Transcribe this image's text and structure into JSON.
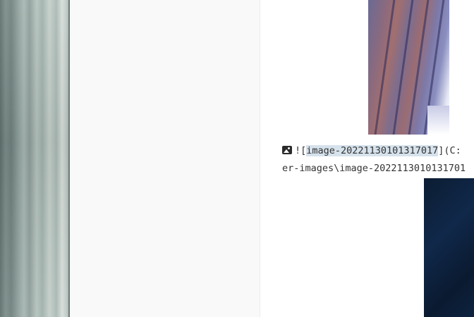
{
  "editor": {
    "markdown_line": {
      "prefix": "![",
      "alt_text": "image-20221130101317017",
      "suffix": "](C:",
      "continuation": "er-images\\image-2022113010131701"
    }
  },
  "icons": {
    "image_icon": "image-icon"
  },
  "colors": {
    "selection": "#d6e2ec",
    "sidebar_bg": "#f9f9f9",
    "editor_bg": "#ffffff"
  }
}
